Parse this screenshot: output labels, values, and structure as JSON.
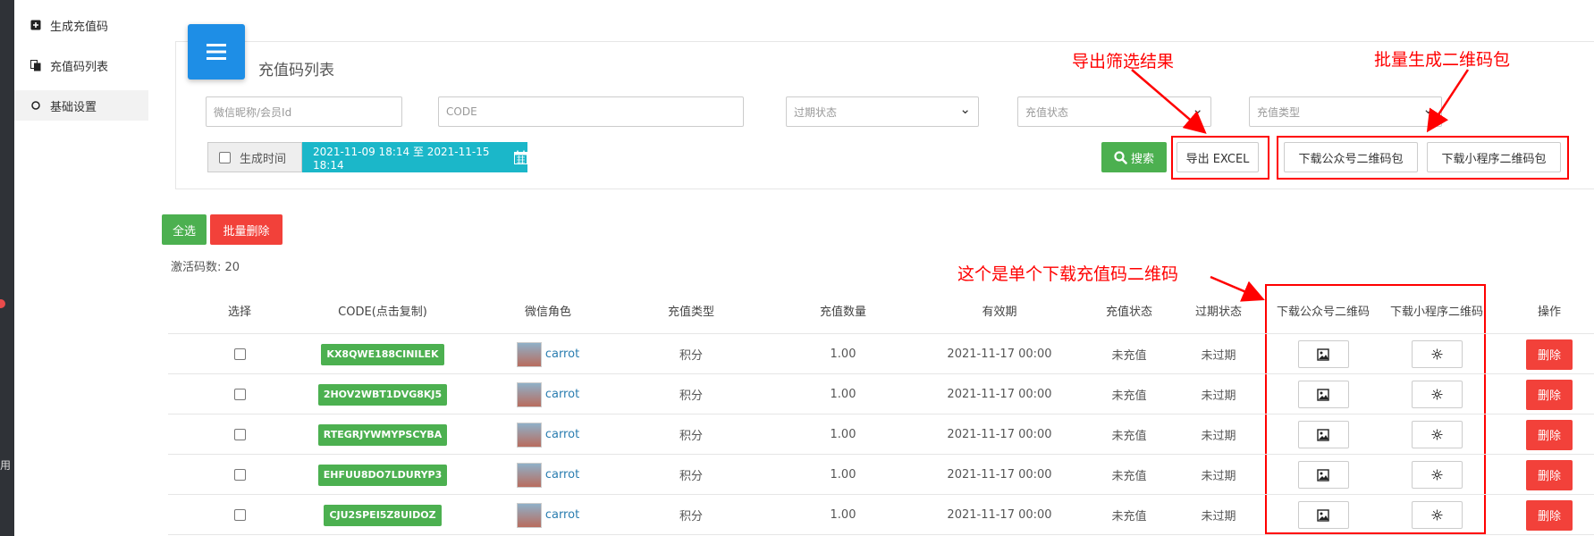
{
  "sidebar": {
    "items": [
      {
        "label": "生成充值码",
        "icon": "plus-square-icon"
      },
      {
        "label": "充值码列表",
        "icon": "copy-icon"
      },
      {
        "label": "基础设置",
        "icon": "circle-icon"
      }
    ],
    "edge_text": "用"
  },
  "panel": {
    "title": "充值码列表",
    "filters": {
      "nickname_placeholder": "微信昵称/会员Id",
      "code_placeholder": "CODE",
      "expire_status": "过期状态",
      "recharge_status": "充值状态",
      "recharge_type": "充值类型"
    },
    "date": {
      "label": "生成时间",
      "range": "2021-11-09 18:14 至 2021-11-15 18:14"
    },
    "buttons": {
      "search": "搜索",
      "export": "导出 EXCEL",
      "download_official": "下载公众号二维码包",
      "download_mini": "下载小程序二维码包"
    }
  },
  "annotations": {
    "export": "导出筛选结果",
    "batch": "批量生成二维码包",
    "single": "这个是单个下载充值码二维码"
  },
  "actions": {
    "select_all": "全选",
    "batch_delete": "批量删除"
  },
  "count_text": "激活码数: 20",
  "table": {
    "headers": [
      "选择",
      "CODE(点击复制)",
      "微信角色",
      "充值类型",
      "充值数量",
      "有效期",
      "充值状态",
      "过期状态",
      "下载公众号二维码",
      "下载小程序二维码",
      "操作"
    ],
    "rows": [
      {
        "code": "KX8QWE188CINILEK",
        "user": "carrot",
        "type": "积分",
        "amount": "1.00",
        "valid": "2021-11-17 00:00",
        "recharge": "未充值",
        "expire": "未过期",
        "delete": "删除"
      },
      {
        "code": "2HOV2WBT1DVG8KJ5",
        "user": "carrot",
        "type": "积分",
        "amount": "1.00",
        "valid": "2021-11-17 00:00",
        "recharge": "未充值",
        "expire": "未过期",
        "delete": "删除"
      },
      {
        "code": "RTEGRJYWMYPSCYBA",
        "user": "carrot",
        "type": "积分",
        "amount": "1.00",
        "valid": "2021-11-17 00:00",
        "recharge": "未充值",
        "expire": "未过期",
        "delete": "删除"
      },
      {
        "code": "EHFUU8DO7LDURYP3",
        "user": "carrot",
        "type": "积分",
        "amount": "1.00",
        "valid": "2021-11-17 00:00",
        "recharge": "未充值",
        "expire": "未过期",
        "delete": "删除"
      },
      {
        "code": "CJU2SPEI5Z8UIDOZ",
        "user": "carrot",
        "type": "积分",
        "amount": "1.00",
        "valid": "2021-11-17 00:00",
        "recharge": "未充值",
        "expire": "未过期",
        "delete": "删除"
      }
    ]
  },
  "colors": {
    "primary_blue": "#1e8ee6",
    "green": "#4cb050",
    "red": "#f2413a",
    "cyan": "#1bb7c9",
    "annotation_red": "#ff0000"
  }
}
